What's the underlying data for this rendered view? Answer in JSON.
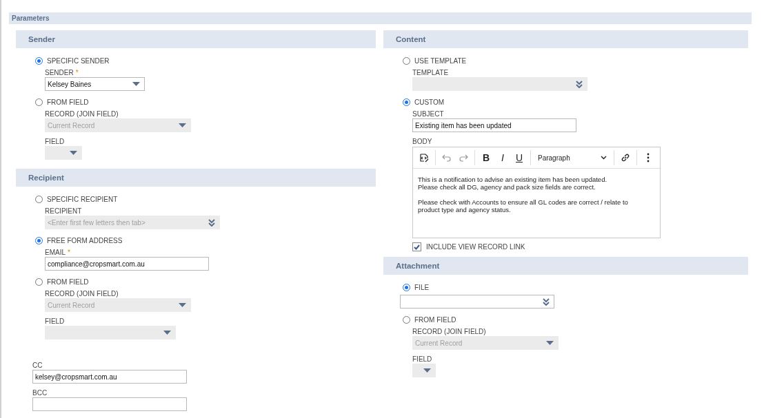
{
  "parameters_title": "Parameters",
  "columns": [
    {
      "sections": [
        {
          "title": "Sender",
          "items": [
            {
              "kind": "radio",
              "label": "SPECIFIC SENDER",
              "selected": true,
              "children": [
                {
                  "kind": "select",
                  "label": "SENDER",
                  "required_mark": "*",
                  "value": "Kelsey Baines",
                  "disabled": false
                }
              ]
            },
            {
              "kind": "radio",
              "label": "FROM FIELD",
              "selected": false,
              "children": [
                {
                  "kind": "select",
                  "label": "RECORD (JOIN FIELD)",
                  "value": "Current Record",
                  "disabled": true
                },
                {
                  "kind": "select",
                  "label": "FIELD",
                  "disabled": true
                }
              ]
            }
          ]
        },
        {
          "title": "Recipient",
          "items": [
            {
              "kind": "radio",
              "label": "SPECIFIC RECIPIENT",
              "selected": false,
              "children": [
                {
                  "kind": "lookup",
                  "label": "RECIPIENT",
                  "placeholder": "<Enter first few letters then tab>",
                  "disabled": true
                }
              ]
            },
            {
              "kind": "radio",
              "label": "FREE FORM ADDRESS",
              "selected": true,
              "children": [
                {
                  "kind": "text",
                  "label": "EMAIL",
                  "required_mark": "*",
                  "value": "compliance@cropsmart.com.au"
                }
              ]
            },
            {
              "kind": "radio",
              "label": "FROM FIELD",
              "selected": false,
              "children": [
                {
                  "kind": "select",
                  "label": "RECORD (JOIN FIELD)",
                  "value": "Current Record",
                  "disabled": true
                },
                {
                  "kind": "select",
                  "label": "FIELD",
                  "disabled": true
                }
              ]
            },
            {
              "kind": "text",
              "label": "CC",
              "value": "kelsey@cropsmart.com.au"
            },
            {
              "kind": "text",
              "label": "BCC"
            }
          ]
        }
      ]
    },
    {
      "sections": [
        {
          "title": "Content",
          "items": [
            {
              "kind": "radio",
              "label": "USE TEMPLATE",
              "selected": false,
              "children": [
                {
                  "kind": "lookup",
                  "label": "TEMPLATE",
                  "disabled": true
                }
              ]
            },
            {
              "kind": "radio",
              "label": "CUSTOM",
              "selected": true,
              "children": [
                {
                  "kind": "text",
                  "label": "SUBJECT",
                  "value": "Existing item has been updated"
                },
                {
                  "kind": "editor",
                  "label": "BODY",
                  "format": "Paragraph",
                  "buttons": [
                    {
                      "kind": "bold",
                      "label": "B"
                    },
                    {
                      "kind": "italic",
                      "label": "I"
                    },
                    {
                      "kind": "underline",
                      "label": "U"
                    }
                  ],
                  "paragraphs": [
                    [
                      "This is a notification to advise an existing item has been updated.",
                      "Please check all DG, agency and pack size fields are correct."
                    ],
                    [
                      "Please check with Accounts to ensure all GL codes are correct / relate to",
                      "product type and agency status."
                    ]
                  ]
                },
                {
                  "kind": "checkbox",
                  "label": "INCLUDE VIEW RECORD LINK",
                  "checked": true
                }
              ]
            }
          ]
        },
        {
          "title": "Attachment",
          "items": [
            {
              "kind": "radio",
              "label": "FILE",
              "selected": true
            },
            {
              "kind": "lookup",
              "disabled": false
            },
            {
              "kind": "radio",
              "label": "FROM FIELD",
              "selected": false,
              "children": [
                {
                  "kind": "select",
                  "label": "RECORD (JOIN FIELD)",
                  "value": "Current Record",
                  "disabled": true
                },
                {
                  "kind": "select",
                  "label": "FIELD",
                  "disabled": true
                }
              ]
            }
          ]
        }
      ]
    }
  ]
}
